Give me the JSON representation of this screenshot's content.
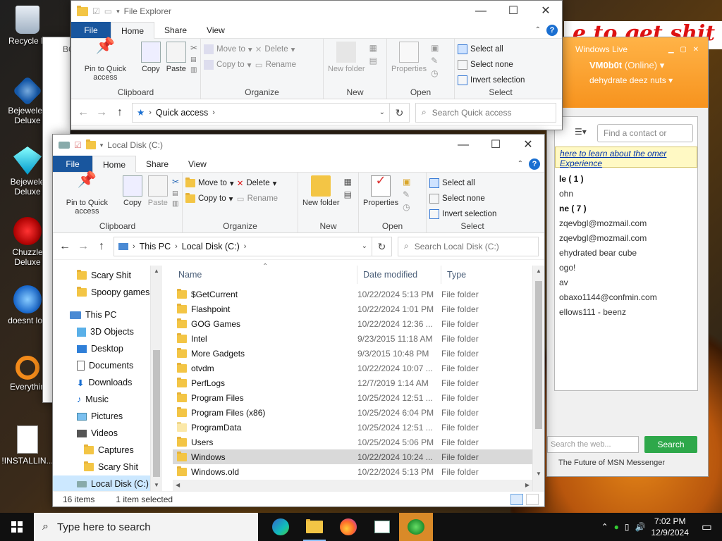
{
  "desktop": {
    "icons": [
      {
        "label": "Recycle Bin",
        "display": "Recycle B"
      },
      {
        "label": "Bejeweled Deluxe",
        "display": "Bejeweled Deluxe"
      },
      {
        "label": "Bejeweled Deluxe",
        "display": "Bejewele Deluxe"
      },
      {
        "label": "Chuzzle Deluxe",
        "display": "Chuzzle Deluxe"
      },
      {
        "label": "doesnt load",
        "display": "doesnt loa"
      },
      {
        "label": "Everything",
        "display": "Everythin"
      },
      {
        "label": "!INSTALLING",
        "display": "!INSTALLIN..."
      }
    ],
    "wallpaper_text": "e to get shit"
  },
  "back_explorer": {
    "title": "File Explorer",
    "tabs": [
      "File",
      "Home",
      "Share",
      "View"
    ],
    "ribbon": {
      "pin": "Pin to Quick access",
      "copy": "Copy",
      "paste": "Paste",
      "move_to": "Move to",
      "copy_to": "Copy to",
      "delete": "Delete",
      "rename": "Rename",
      "new_folder": "New folder",
      "properties": "Properties",
      "select_all": "Select all",
      "select_none": "Select none",
      "invert": "Invert selection",
      "groups": [
        "Clipboard",
        "Organize",
        "New",
        "Open",
        "Select"
      ]
    },
    "address": "Quick access",
    "search_placeholder": "Search Quick access"
  },
  "bg_window_label": "BC",
  "front_explorer": {
    "title": "Local Disk (C:)",
    "tabs": [
      "File",
      "Home",
      "Share",
      "View"
    ],
    "ribbon": {
      "pin": "Pin to Quick access",
      "copy": "Copy",
      "paste": "Paste",
      "move_to": "Move to",
      "copy_to": "Copy to",
      "delete": "Delete",
      "rename": "Rename",
      "new_folder": "New folder",
      "properties": "Properties",
      "select_all": "Select all",
      "select_none": "Select none",
      "invert": "Invert selection",
      "groups": [
        "Clipboard",
        "Organize",
        "New",
        "Open",
        "Select"
      ]
    },
    "address": {
      "crumbs": [
        "This PC",
        "Local Disk (C:)"
      ]
    },
    "search_placeholder": "Search Local Disk (C:)",
    "nav": [
      {
        "label": "Scary Shit",
        "indent": 1,
        "icon": "folder"
      },
      {
        "label": "Spoopy games",
        "indent": 1,
        "icon": "folder"
      },
      {
        "label": "This PC",
        "indent": 0,
        "icon": "pc"
      },
      {
        "label": "3D Objects",
        "indent": 1,
        "icon": "cube"
      },
      {
        "label": "Desktop",
        "indent": 1,
        "icon": "desktop"
      },
      {
        "label": "Documents",
        "indent": 1,
        "icon": "doc"
      },
      {
        "label": "Downloads",
        "indent": 1,
        "icon": "download"
      },
      {
        "label": "Music",
        "indent": 1,
        "icon": "music"
      },
      {
        "label": "Pictures",
        "indent": 1,
        "icon": "picture"
      },
      {
        "label": "Videos",
        "indent": 1,
        "icon": "video"
      },
      {
        "label": "Captures",
        "indent": 2,
        "icon": "folder"
      },
      {
        "label": "Scary Shit",
        "indent": 2,
        "icon": "folder"
      },
      {
        "label": "Local Disk (C:)",
        "indent": 1,
        "icon": "drive",
        "selected": true
      }
    ],
    "columns": [
      "Name",
      "Date modified",
      "Type"
    ],
    "files": [
      {
        "name": "$GetCurrent",
        "date": "10/22/2024 5:13 PM",
        "type": "File folder"
      },
      {
        "name": "Flashpoint",
        "date": "10/22/2024 1:01 PM",
        "type": "File folder"
      },
      {
        "name": "GOG Games",
        "date": "10/22/2024 12:36 ...",
        "type": "File folder"
      },
      {
        "name": "Intel",
        "date": "9/23/2015 11:18 AM",
        "type": "File folder"
      },
      {
        "name": "More Gadgets",
        "date": "9/3/2015 10:48 PM",
        "type": "File folder"
      },
      {
        "name": "otvdm",
        "date": "10/22/2024 10:07 ...",
        "type": "File folder"
      },
      {
        "name": "PerfLogs",
        "date": "12/7/2019 1:14 AM",
        "type": "File folder"
      },
      {
        "name": "Program Files",
        "date": "10/25/2024 12:51 ...",
        "type": "File folder"
      },
      {
        "name": "Program Files (x86)",
        "date": "10/25/2024 6:04 PM",
        "type": "File folder"
      },
      {
        "name": "ProgramData",
        "date": "10/25/2024 12:51 ...",
        "type": "File folder",
        "pale": true
      },
      {
        "name": "Users",
        "date": "10/25/2024 5:06 PM",
        "type": "File folder"
      },
      {
        "name": "Windows",
        "date": "10/22/2024 10:24 ...",
        "type": "File folder",
        "selected": true
      },
      {
        "name": "Windows.old",
        "date": "10/22/2024 5:13 PM",
        "type": "File folder"
      }
    ],
    "status": {
      "count": "16 items",
      "selected": "1 item selected"
    }
  },
  "msn": {
    "brand": "Windows Live",
    "username": "VM0b0t",
    "status": "(Online)",
    "psm": "dehydrate deez nuts",
    "find_placeholder": "Find a contact or numbe",
    "notice": "here to learn about the omer Experience",
    "contacts": [
      {
        "text": "le ( 1 )",
        "group": true
      },
      {
        "text": "ohn"
      },
      {
        "text": "ne ( 7 )",
        "group": true
      },
      {
        "text": "zqevbgl@mozmail.com"
      },
      {
        "text": "zqevbgl@mozmail.com"
      },
      {
        "text": "ehydrated bear cube"
      },
      {
        "text": "ogo!"
      },
      {
        "text": "av"
      },
      {
        "text": "obaxo1144@confmin.com"
      },
      {
        "text": "ellows111 - beenz"
      }
    ],
    "search_placeholder": "Search the web...",
    "search_button": "Search",
    "footer": "The Future of MSN Messenger"
  },
  "taskbar": {
    "search_placeholder": "Type here to search",
    "time": "7:02 PM",
    "date": "12/9/2024"
  },
  "colors": {
    "file_tab": "#19569e",
    "selection": "#cce8ff",
    "msn_orange": "#f7931e",
    "msn_green": "#2ea84a"
  }
}
